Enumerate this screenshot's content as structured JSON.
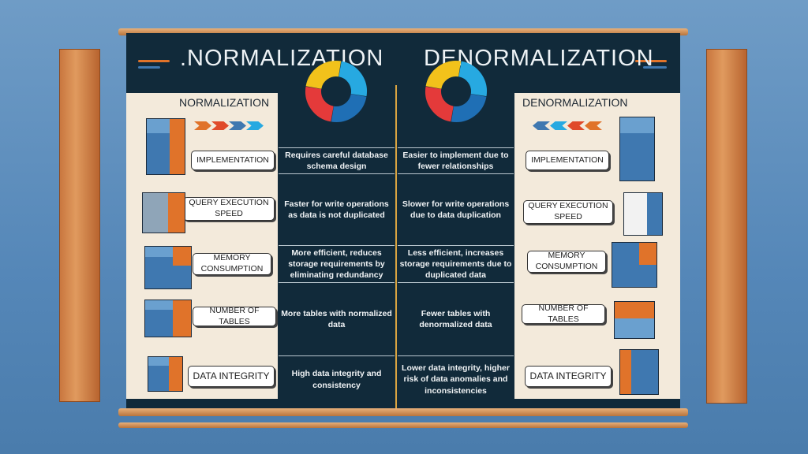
{
  "header": {
    "left_title": ".NORMALIZATION",
    "right_title": "DENORMALIZATION"
  },
  "left_panel_title": "NORMALIZATION",
  "right_panel_title": "DENORMALIZATION",
  "rows": [
    {
      "label": "IMPLEMENTATION",
      "normalization": "Requires careful database schema design",
      "denormalization": "Easier to implement due to fewer relationships"
    },
    {
      "label": "QUERY EXECUTION SPEED",
      "normalization": "Faster for write operations as data is not duplicated",
      "denormalization": "Slower for write operations due to data duplication"
    },
    {
      "label": "MEMORY CONSUMPTION",
      "normalization": "More efficient, reduces storage requirements by eliminating redundancy",
      "denormalization": "Less efficient, increases storage requirements due to duplicated data"
    },
    {
      "label": "NUMBER OF TABLES",
      "normalization": "More tables with normalized data",
      "denormalization": "Fewer tables with denormalized data"
    },
    {
      "label": "DATA INTEGRITY",
      "normalization": "High data integrity and consistency",
      "denormalization": "Lower data integrity, higher risk of data anomalies and inconsistencies"
    }
  ],
  "colors": {
    "banner": "#112a3a",
    "panel": "#f3eadb",
    "divider": "#d9a441",
    "blue": "#3f78b0",
    "orange": "#e0732a"
  }
}
